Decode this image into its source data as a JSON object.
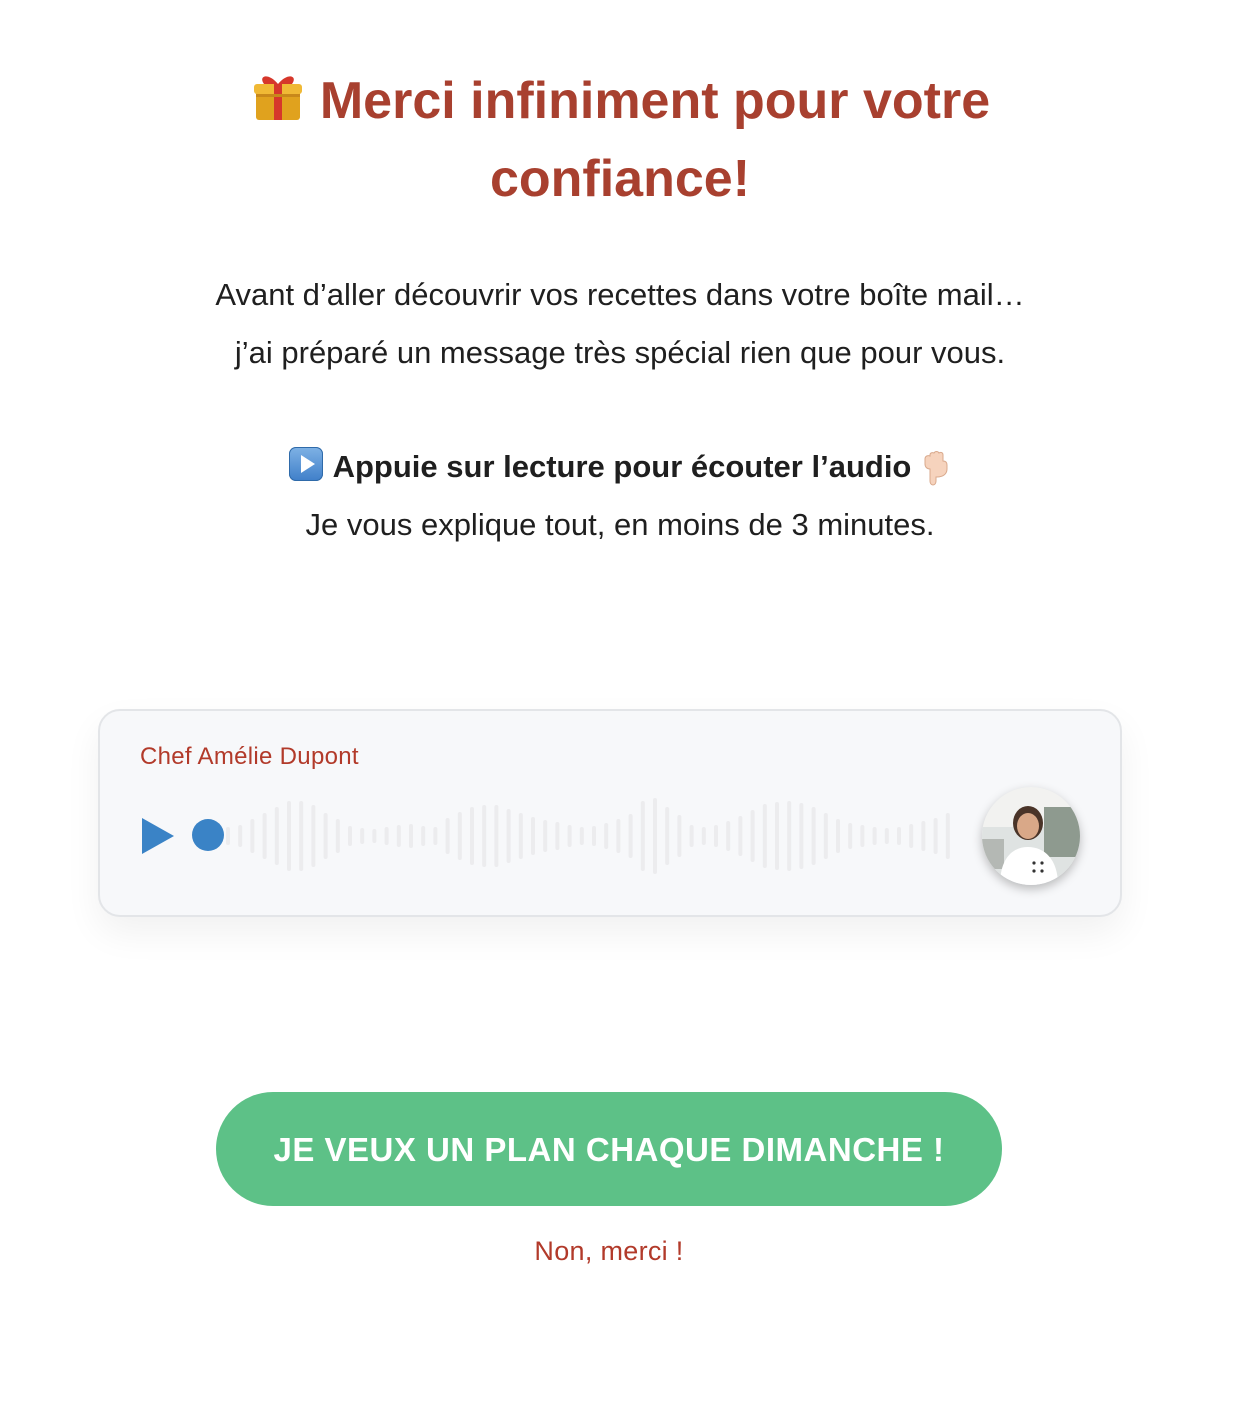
{
  "header": {
    "title": "Merci infiniment pour votre confiance!",
    "icon": "gift-icon"
  },
  "intro": {
    "line1": "Avant d’aller découvrir vos recettes dans votre boîte mail…",
    "line2": "j’ai préparé un message très spécial rien que pour vous."
  },
  "cta": {
    "instruction": "Appuie sur lecture pour écouter l’audio",
    "subtext": "Je vous explique tout, en moins de 3 minutes.",
    "play_emoji": "play-button-emoji-icon",
    "finger_emoji": "pointing-down-icon"
  },
  "player": {
    "name": "Chef Amélie Dupont",
    "progress": 0,
    "colors": {
      "accent": "#3a83c6",
      "wave": "#ececee",
      "name": "#b23a2a"
    }
  },
  "actions": {
    "main_button": "JE VEUX UN PLAN CHAQUE DIMANCHE !",
    "decline": "Non, merci !",
    "main_color": "#5dc187"
  },
  "colors": {
    "title": "#a8402f"
  }
}
